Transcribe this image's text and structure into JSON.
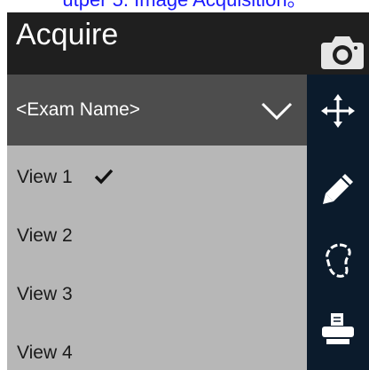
{
  "caption": {
    "text": "utper 5. Image Acquisition。",
    "color": "#1a1aff"
  },
  "header": {
    "title": "Acquire",
    "camera_icon": "camera-icon"
  },
  "exam_dropdown": {
    "selected": "<Exam Name>",
    "icon": "chevron-down-icon"
  },
  "views": [
    {
      "label": "View 1",
      "checked": true
    },
    {
      "label": "View 2",
      "checked": false
    },
    {
      "label": "View 3",
      "checked": false
    },
    {
      "label": "View 4",
      "checked": false
    }
  ],
  "toolbar": {
    "tools": [
      "move-arrows-icon",
      "pencil-icon",
      "lasso-icon",
      "printer-icon"
    ]
  },
  "colors": {
    "header_bg": "#1f1f1f",
    "dropdown_bg": "#4d4d4d",
    "list_bg": "#b7b7b7",
    "toolbar_bg": "#0b1b2c"
  }
}
